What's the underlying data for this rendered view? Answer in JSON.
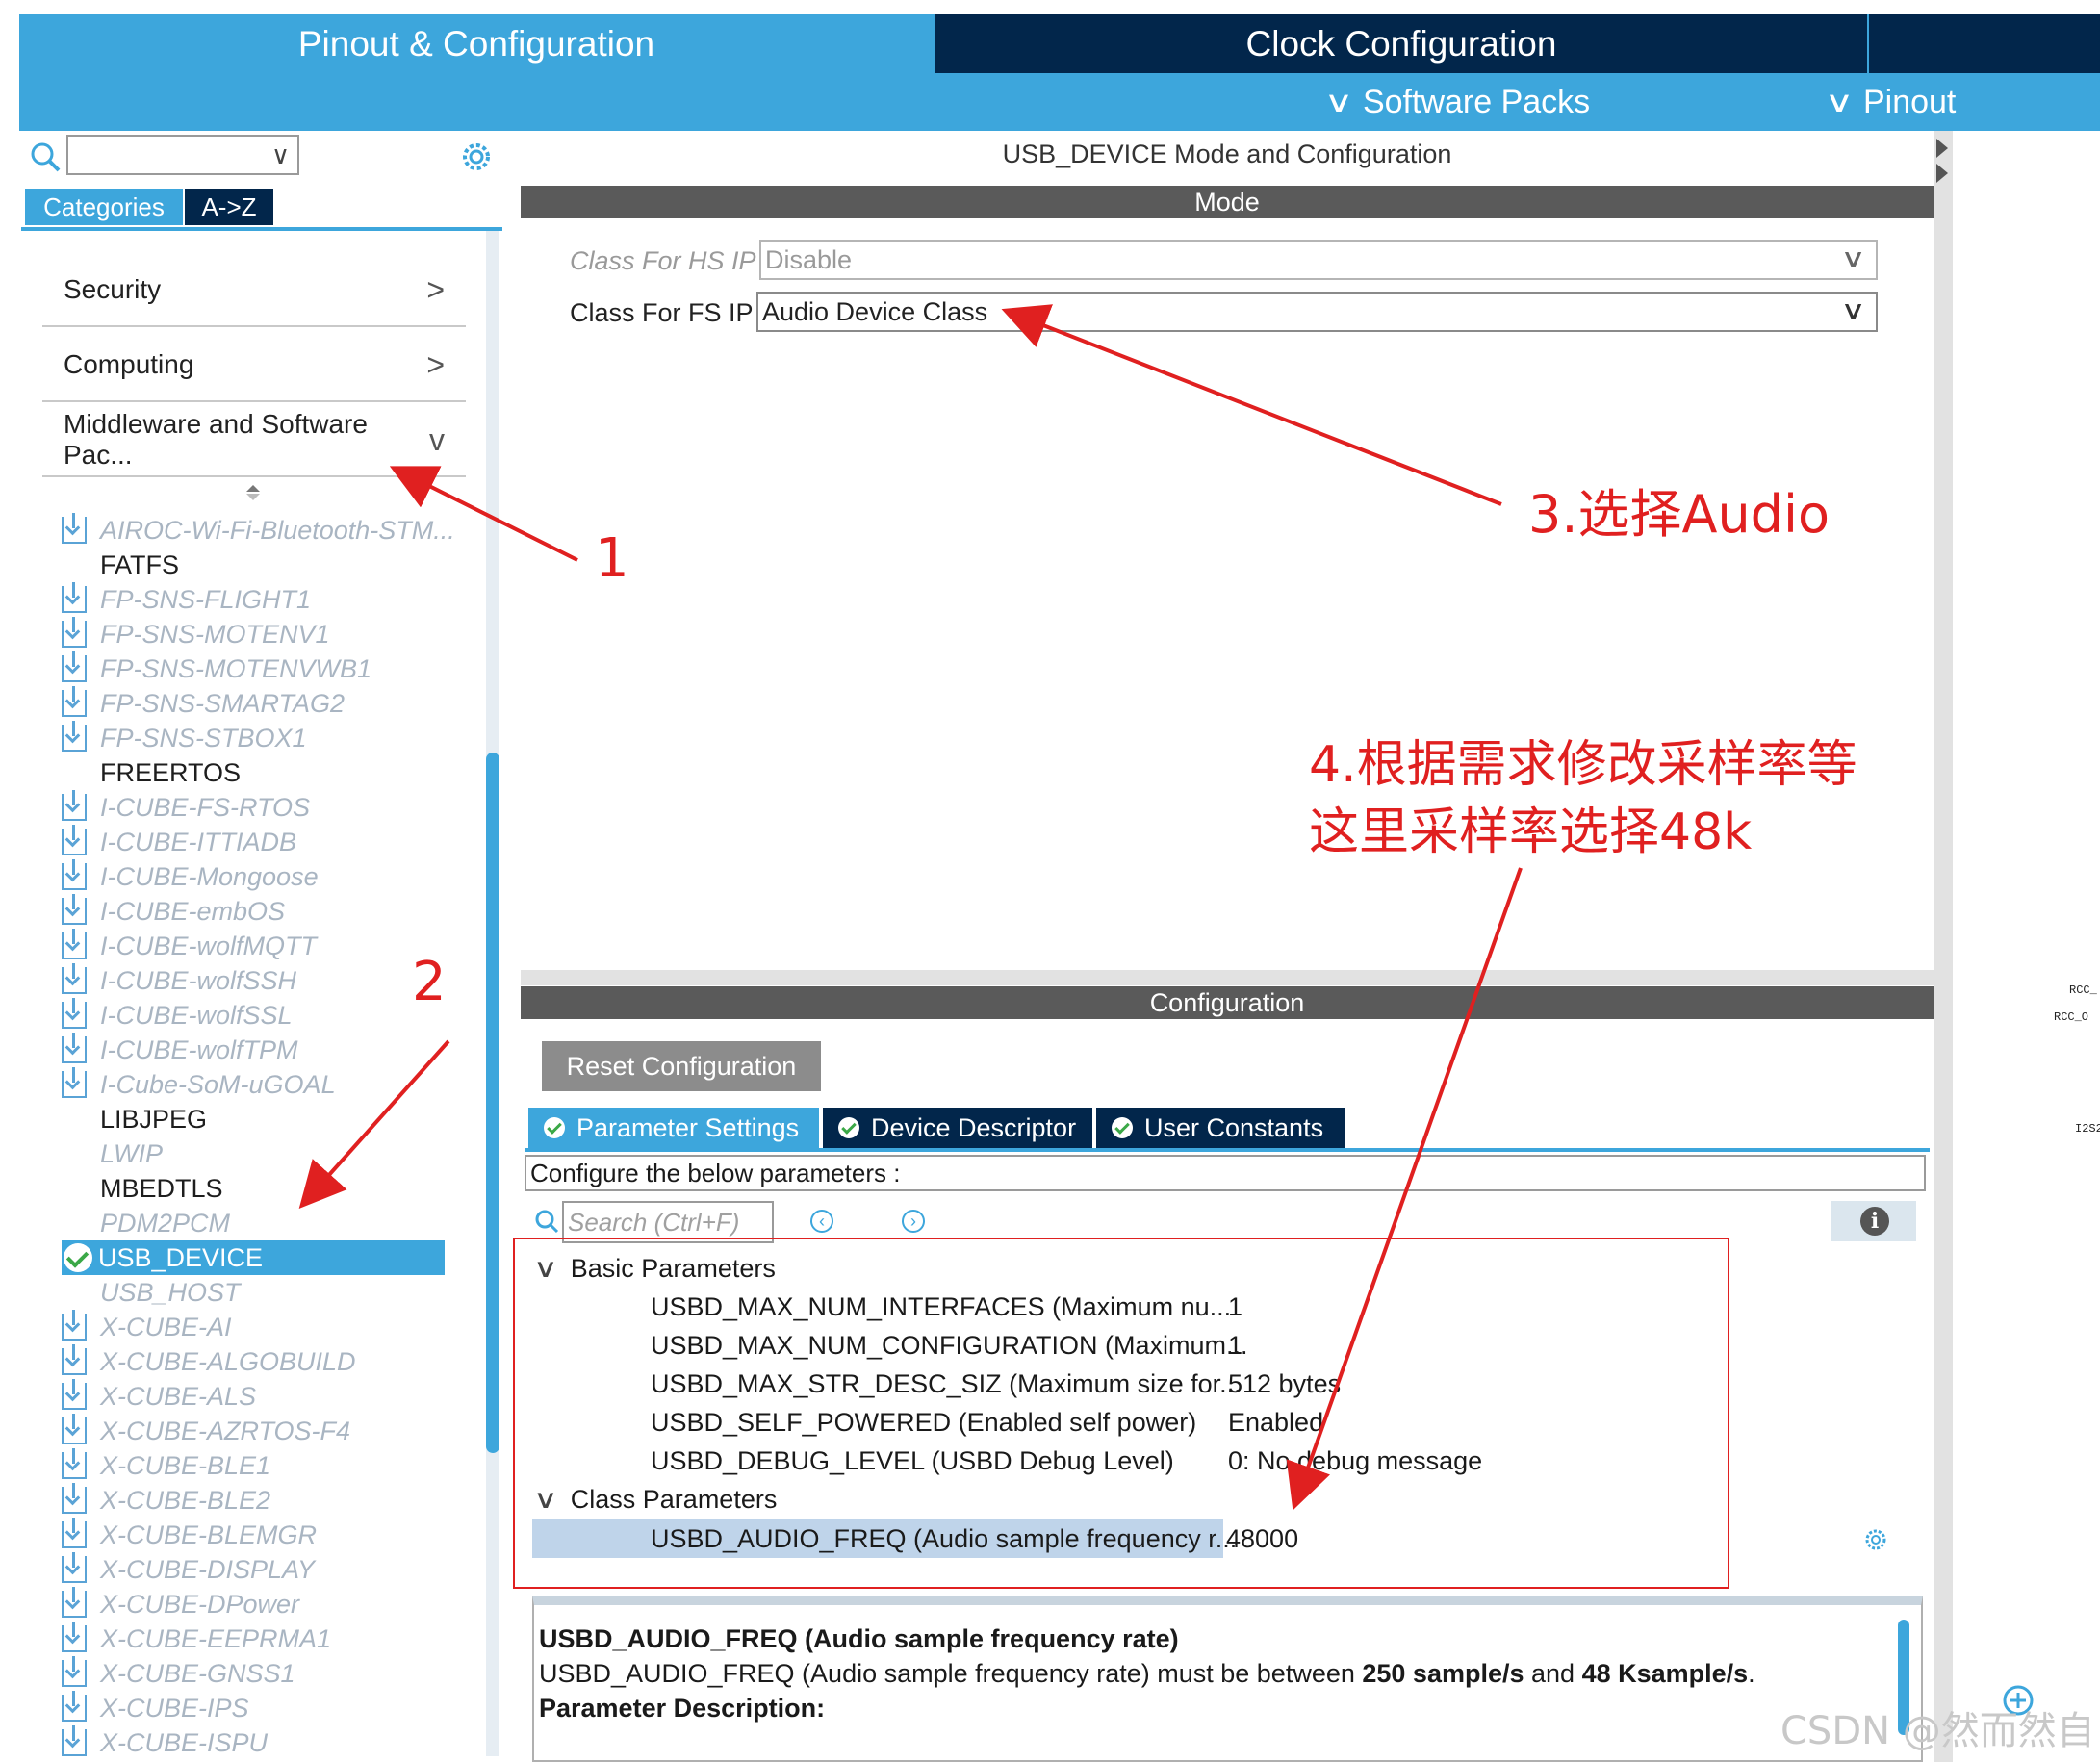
{
  "header": {
    "tabs": [
      "Pinout & Configuration",
      "Clock Configuration",
      ""
    ],
    "subtabs": [
      "Software Packs",
      "Pinout"
    ]
  },
  "left_panel": {
    "category_tabs": [
      "Categories",
      "A->Z"
    ],
    "sections": [
      {
        "label": "Security",
        "state": ">"
      },
      {
        "label": "Computing",
        "state": ">"
      },
      {
        "label": "Middleware and Software Pac...",
        "state": "v"
      }
    ],
    "items": [
      {
        "label": "AIROC-Wi-Fi-Bluetooth-STM...",
        "style": "gray",
        "icon": "download-icon"
      },
      {
        "label": "FATFS",
        "style": "dark",
        "icon": ""
      },
      {
        "label": "FP-SNS-FLIGHT1",
        "style": "gray",
        "icon": "download-icon"
      },
      {
        "label": "FP-SNS-MOTENV1",
        "style": "gray",
        "icon": "download-icon"
      },
      {
        "label": "FP-SNS-MOTENVWB1",
        "style": "gray",
        "icon": "download-icon"
      },
      {
        "label": "FP-SNS-SMARTAG2",
        "style": "gray",
        "icon": "download-icon"
      },
      {
        "label": "FP-SNS-STBOX1",
        "style": "gray",
        "icon": "download-icon"
      },
      {
        "label": "FREERTOS",
        "style": "dark",
        "icon": ""
      },
      {
        "label": "I-CUBE-FS-RTOS",
        "style": "gray",
        "icon": "download-icon"
      },
      {
        "label": "I-CUBE-ITTIADB",
        "style": "gray",
        "icon": "download-icon"
      },
      {
        "label": "I-CUBE-Mongoose",
        "style": "gray",
        "icon": "download-icon"
      },
      {
        "label": "I-CUBE-embOS",
        "style": "gray",
        "icon": "download-icon"
      },
      {
        "label": "I-CUBE-wolfMQTT",
        "style": "gray",
        "icon": "download-icon"
      },
      {
        "label": "I-CUBE-wolfSSH",
        "style": "gray",
        "icon": "download-icon"
      },
      {
        "label": "I-CUBE-wolfSSL",
        "style": "gray",
        "icon": "download-icon"
      },
      {
        "label": "I-CUBE-wolfTPM",
        "style": "gray",
        "icon": "download-icon"
      },
      {
        "label": "I-Cube-SoM-uGOAL",
        "style": "gray",
        "icon": "download-icon"
      },
      {
        "label": "LIBJPEG",
        "style": "dark",
        "icon": ""
      },
      {
        "label": "LWIP",
        "style": "gray",
        "icon": ""
      },
      {
        "label": "MBEDTLS",
        "style": "dark",
        "icon": ""
      },
      {
        "label": "PDM2PCM",
        "style": "gray",
        "icon": ""
      },
      {
        "label": "USB_DEVICE",
        "style": "selected",
        "icon": "check-icon"
      },
      {
        "label": "USB_HOST",
        "style": "gray",
        "icon": ""
      },
      {
        "label": "X-CUBE-AI",
        "style": "gray",
        "icon": "download-icon"
      },
      {
        "label": "X-CUBE-ALGOBUILD",
        "style": "gray",
        "icon": "download-icon"
      },
      {
        "label": "X-CUBE-ALS",
        "style": "gray",
        "icon": "download-icon"
      },
      {
        "label": "X-CUBE-AZRTOS-F4",
        "style": "gray",
        "icon": "download-icon"
      },
      {
        "label": "X-CUBE-BLE1",
        "style": "gray",
        "icon": "download-icon"
      },
      {
        "label": "X-CUBE-BLE2",
        "style": "gray",
        "icon": "download-icon"
      },
      {
        "label": "X-CUBE-BLEMGR",
        "style": "gray",
        "icon": "download-icon"
      },
      {
        "label": "X-CUBE-DISPLAY",
        "style": "gray",
        "icon": "download-icon"
      },
      {
        "label": "X-CUBE-DPower",
        "style": "gray",
        "icon": "download-icon"
      },
      {
        "label": "X-CUBE-EEPRMA1",
        "style": "gray",
        "icon": "download-icon"
      },
      {
        "label": "X-CUBE-GNSS1",
        "style": "gray",
        "icon": "download-icon"
      },
      {
        "label": "X-CUBE-IPS",
        "style": "gray",
        "icon": "download-icon"
      },
      {
        "label": "X-CUBE-ISPU",
        "style": "gray",
        "icon": "download-icon"
      }
    ]
  },
  "center": {
    "title": "USB_DEVICE Mode and Configuration",
    "mode_header": "Mode",
    "hs_label": "Class For HS IP",
    "hs_value": "Disable",
    "fs_label": "Class For FS IP",
    "fs_value": "Audio Device Class",
    "config_header": "Configuration",
    "reset_label": "Reset Configuration",
    "config_tabs": [
      "Parameter Settings",
      "Device Descriptor",
      "User Constants"
    ],
    "hint": "Configure the below parameters :",
    "search_placeholder": "Search (Ctrl+F)",
    "groups": [
      {
        "name": "Basic Parameters",
        "params": [
          {
            "name": "USBD_MAX_NUM_INTERFACES (Maximum nu...",
            "value": "1"
          },
          {
            "name": "USBD_MAX_NUM_CONFIGURATION (Maximum...",
            "value": "1"
          },
          {
            "name": "USBD_MAX_STR_DESC_SIZ (Maximum size for...",
            "value": "512 bytes"
          },
          {
            "name": "USBD_SELF_POWERED (Enabled self power)",
            "value": "Enabled"
          },
          {
            "name": "USBD_DEBUG_LEVEL (USBD Debug Level)",
            "value": "0: No debug message"
          }
        ]
      },
      {
        "name": "Class Parameters",
        "params": [
          {
            "name": "USBD_AUDIO_FREQ (Audio sample frequency r...",
            "value": "48000"
          }
        ]
      }
    ],
    "description": {
      "title": "USBD_AUDIO_FREQ (Audio sample frequency rate)",
      "line_prefix": "USBD_AUDIO_FREQ (Audio sample frequency rate) must be between ",
      "min": "250 sample/s",
      "mid": " and ",
      "max": "48 Ksample/s",
      "end": ".",
      "param_heading": "Parameter Description:"
    }
  },
  "right_edge": {
    "labels": [
      "RCC_",
      "RCC_O",
      "I2S2"
    ]
  },
  "annotations": {
    "step1": "1",
    "step2": "2",
    "step3": "3.选择Audio",
    "step4_line1": "4.根据需求修改采样率等",
    "step4_line2": "这里采样率选择48k",
    "color": "#e02020"
  },
  "watermark": "CSDN @然而然自"
}
